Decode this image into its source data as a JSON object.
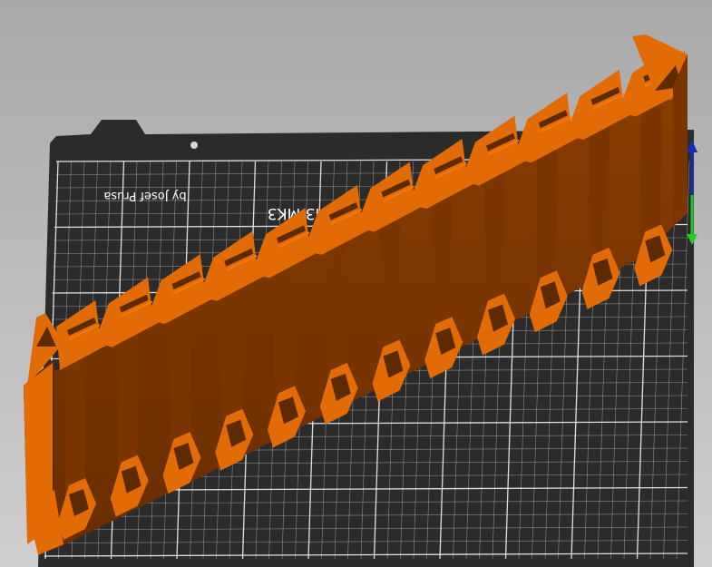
{
  "viewport": {
    "background_top": "#a9a9a9",
    "background_bottom": "#cfcfcf"
  },
  "bed": {
    "surface_color": "#2b2b2b",
    "grid_color": "#ffffff",
    "label_main": "AL PRUSA i3 MK3",
    "label_sub": "by Josef Prusa"
  },
  "model": {
    "name": "orange-rack-model",
    "color_face": "#e36b06",
    "color_top": "#f07a10",
    "color_shadow": "#7a3500",
    "color_dark": "#5e2a00",
    "slot_count": 12
  },
  "gizmo": {
    "z_axis_color": "#1a2cb0",
    "y_axis_color": "#22cc22"
  }
}
